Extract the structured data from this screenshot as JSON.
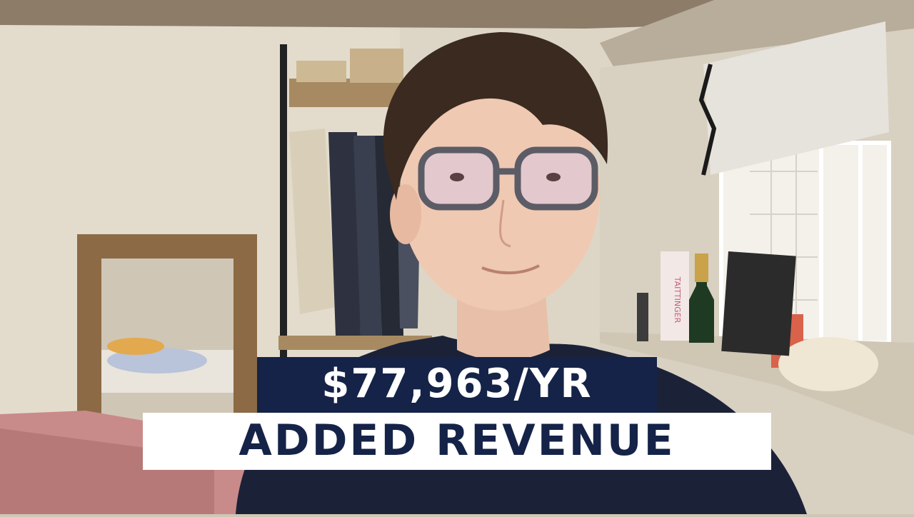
{
  "caption": {
    "line1": "$77,963/YR",
    "line2": "ADDED REVENUE"
  },
  "scene": {
    "description_tag": "person-on-video-call-bedroom",
    "colors": {
      "caption_navy": "#152348",
      "caption_white": "#ffffff",
      "wall": "#ddd6c6",
      "shirt": "#1b2238",
      "hair": "#3a2a20",
      "blanket": "#c98a8a",
      "window_light": "#f3f1ea"
    }
  }
}
